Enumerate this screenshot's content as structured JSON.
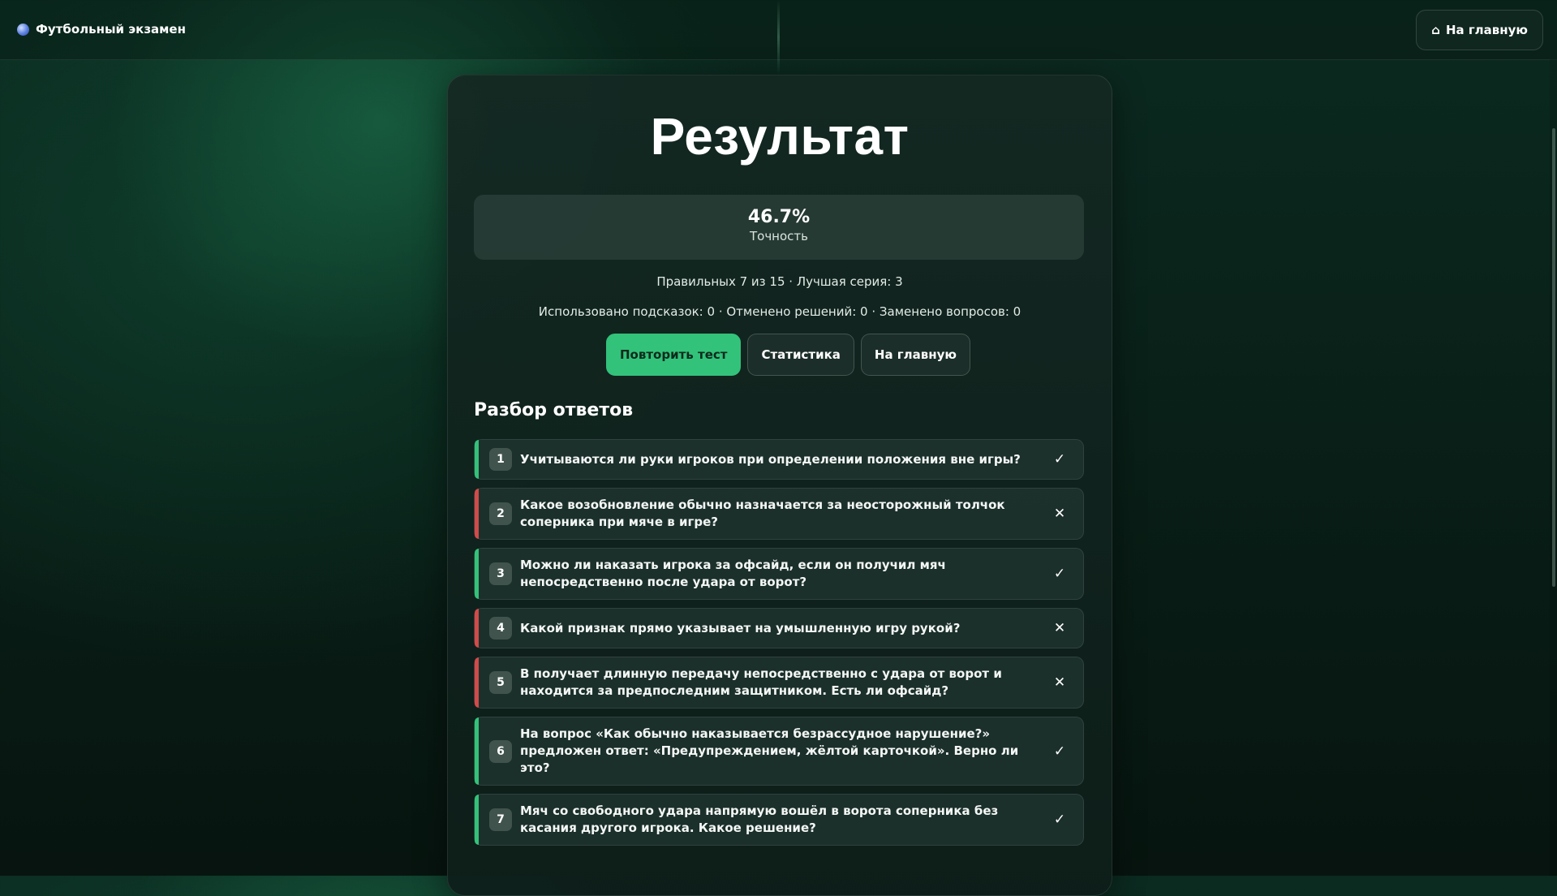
{
  "header": {
    "brand": "Футбольный экзамен",
    "home_icon": "⌂",
    "home_label": "На главную"
  },
  "result": {
    "title": "Результат",
    "accuracy": "46.7%",
    "accuracy_label": "Точность",
    "summary": "Правильных 7 из 15 · Лучшая серия: 3",
    "usage": "Использовано подсказок: 0 · Отменено решений: 0 · Заменено вопросов: 0"
  },
  "actions": {
    "retry": "Повторить тест",
    "stats": "Статистика",
    "home": "На главную"
  },
  "review": {
    "title": "Разбор ответов",
    "items": [
      {
        "n": "1",
        "text": "Учитываются ли руки игроков при определении положения вне игры?",
        "status": "ok",
        "mark": "✓"
      },
      {
        "n": "2",
        "text": "Какое возобновление обычно назначается за неосторожный толчок соперника при мяче в игре?",
        "status": "bad",
        "mark": "✕"
      },
      {
        "n": "3",
        "text": "Можно ли наказать игрока за офсайд, если он получил мяч непосредственно после удара от ворот?",
        "status": "ok",
        "mark": "✓"
      },
      {
        "n": "4",
        "text": "Какой признак прямо указывает на умышленную игру рукой?",
        "status": "bad",
        "mark": "✕"
      },
      {
        "n": "5",
        "text": "В получает длинную передачу непосредственно с удара от ворот и находится за предпоследним защитником. Есть ли офсайд?",
        "status": "bad",
        "mark": "✕"
      },
      {
        "n": "6",
        "text": "На вопрос «Как обычно наказывается безрассудное нарушение?» предложен ответ: «Предупреждением, жёлтой карточкой». Верно ли это?",
        "status": "ok",
        "mark": "✓"
      },
      {
        "n": "7",
        "text": "Мяч со свободного удара напрямую вошёл в ворота соперника без касания другого игрока. Какое решение?",
        "status": "ok",
        "mark": "✓"
      }
    ]
  }
}
